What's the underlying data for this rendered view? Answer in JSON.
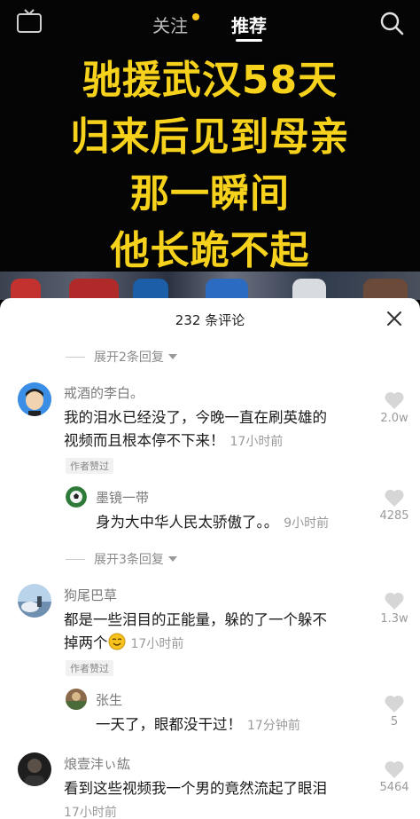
{
  "header": {
    "tab_follow": "关注",
    "tab_recommend": "推荐",
    "live_icon_text": "直播"
  },
  "video": {
    "overlay_lines": [
      "驰援武汉58天",
      "归来后见到母亲",
      "那一瞬间",
      "他长跪不起"
    ]
  },
  "comments_panel": {
    "title": "232 条评论",
    "items": [
      {
        "kind": "expand",
        "label": "展开2条回复"
      },
      {
        "kind": "comment",
        "user": "戒酒的李白。",
        "text_line1": "我的泪水已经没了，今晚一直在刷英雄的",
        "text_line2": "视频而且根本停不下来！",
        "time": "17小时前",
        "badge": "作者赞过",
        "likes": "2.0w"
      },
      {
        "kind": "reply",
        "user": "墨镜一带",
        "text": "身为大中华人民太骄傲了。。",
        "time": "9小时前",
        "likes": "4285"
      },
      {
        "kind": "expand",
        "label": "展开3条回复"
      },
      {
        "kind": "comment",
        "user": "狗尾巴草",
        "text_line1": "都是一些泪目的正能量，躲的了一个躲不",
        "text_line2": "掉两个",
        "time": "17小时前",
        "badge": "作者赞过",
        "likes": "1.3w"
      },
      {
        "kind": "reply",
        "user": "张生",
        "text": "一天了，眼都没干过！",
        "time": "17分钟前",
        "likes": "5"
      },
      {
        "kind": "comment",
        "user": "烺壹沣ぃ紘",
        "text_line1": "看到这些视频我一个男的竟然流起了眼泪",
        "text_line2": "",
        "time": "17小时前",
        "likes": "5464"
      }
    ]
  }
}
